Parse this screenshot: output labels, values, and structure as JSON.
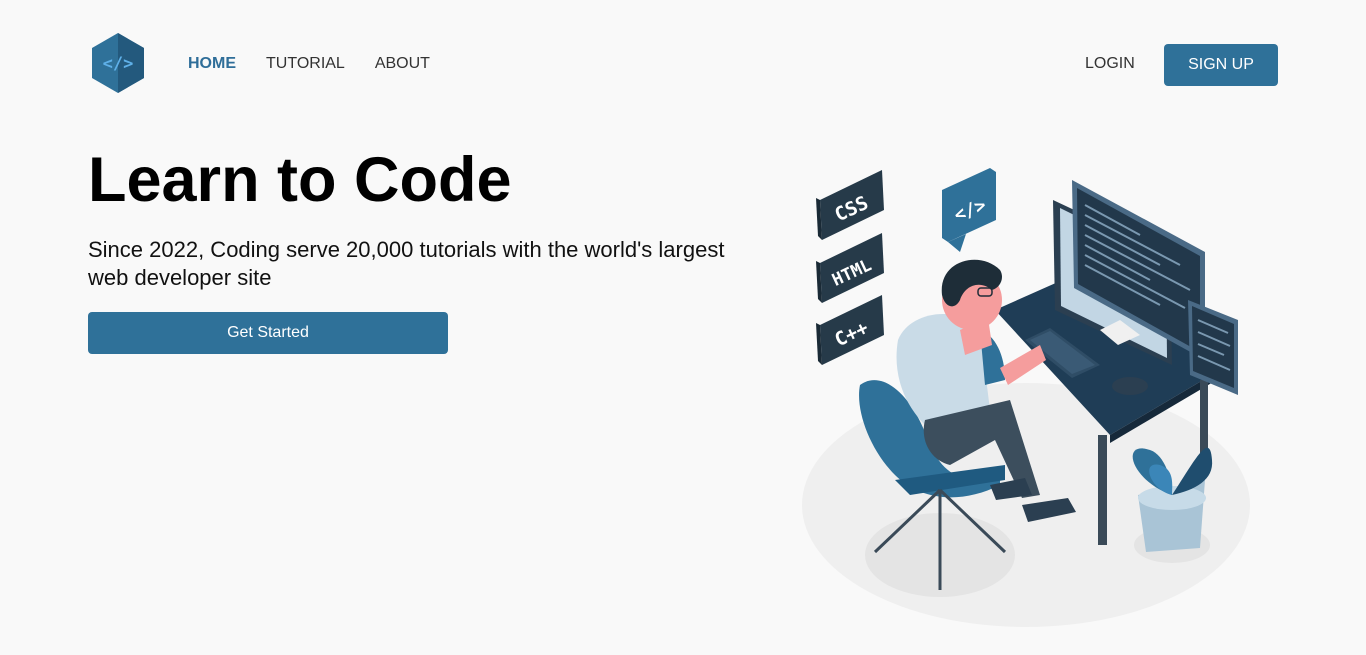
{
  "header": {
    "logo_glyph": "</>",
    "nav": [
      {
        "label": "HOME",
        "active": true
      },
      {
        "label": "TUTORIAL",
        "active": false
      },
      {
        "label": "ABOUT",
        "active": false
      }
    ],
    "login_label": "LOGIN",
    "signup_label": "SIGN UP"
  },
  "hero": {
    "title": "Learn to Code",
    "subtitle": "Since 2022, Coding serve 20,000 tutorials with the world's largest web developer site",
    "cta_label": "Get Started"
  },
  "illustration": {
    "tags": [
      "CSS",
      "HTML",
      "C++"
    ],
    "bubble_glyph": "</>"
  },
  "colors": {
    "accent": "#2f7199",
    "accent_dark": "#1f3d56",
    "background": "#f9f9f9"
  }
}
